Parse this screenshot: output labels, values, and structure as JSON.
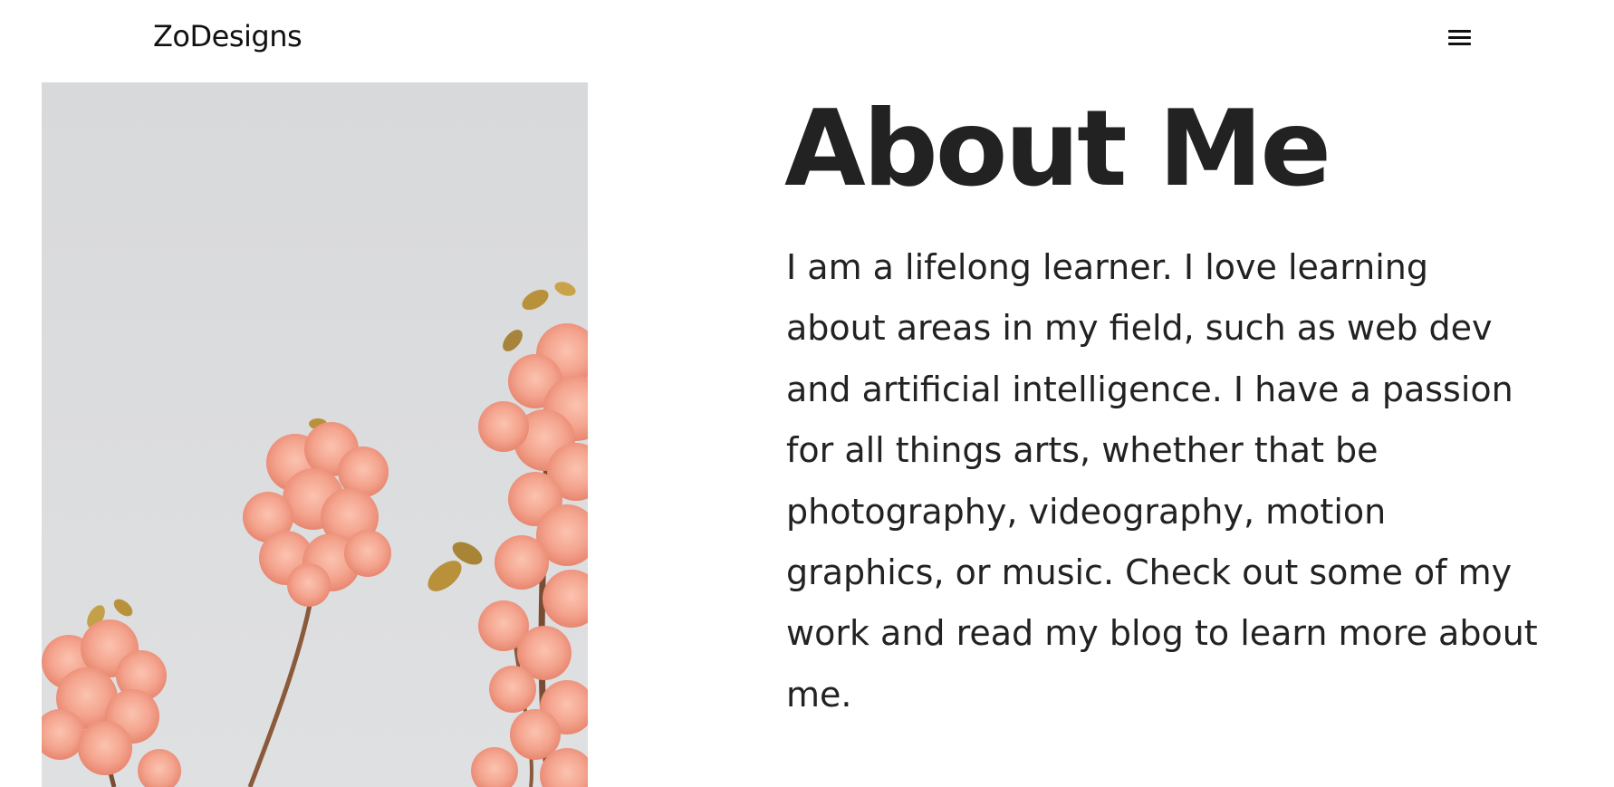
{
  "header": {
    "logo_text": "ZoDesigns",
    "menu_icon": "hamburger-menu-icon"
  },
  "hero_image": {
    "subject": "pink cherry blossom branches against a pale grey sky"
  },
  "about": {
    "title": "About Me",
    "body": "I am a lifelong learner. I love learning about areas in my field, such as web dev and artificial intelligence. I have a passion for all things arts, whether that be photography, videography, motion graphics, or music. Check out some of my work and read my blog to learn more about me."
  },
  "colors": {
    "text": "#222222",
    "background": "#ffffff",
    "sky": "#d9dadc",
    "blossom": "#f4a48e",
    "blossom_dark": "#e07e6a",
    "stem": "#8a5a3a",
    "leaf": "#b8913a"
  }
}
